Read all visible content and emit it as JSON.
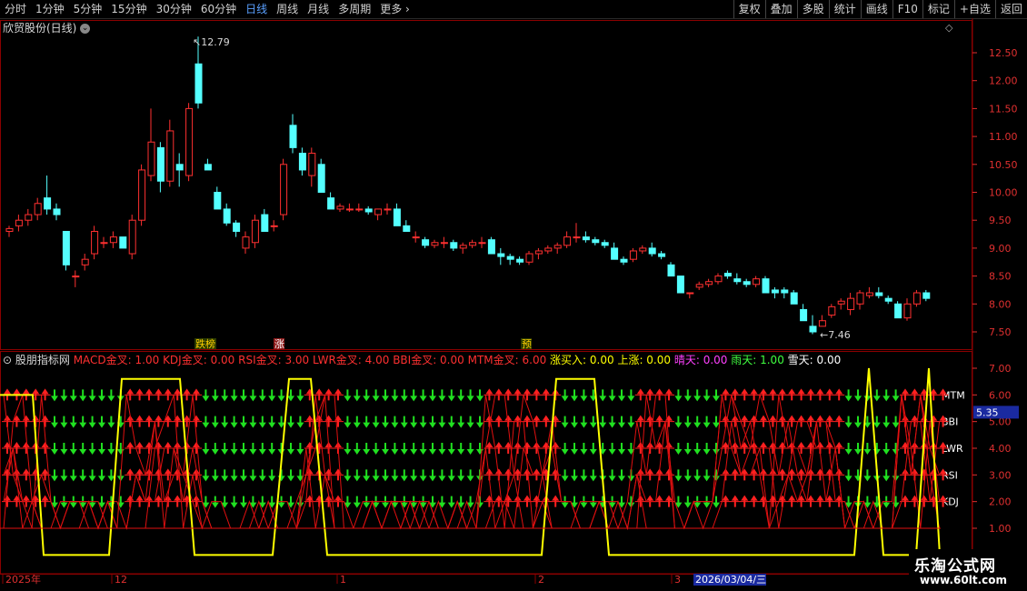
{
  "toolbar": {
    "periods": [
      "分时",
      "1分钟",
      "5分钟",
      "15分钟",
      "30分钟",
      "60分钟",
      "日线",
      "周线",
      "月线",
      "多周期",
      "更多"
    ],
    "active_period": "日线",
    "right_buttons": [
      "复权",
      "叠加",
      "多股",
      "统计",
      "画线",
      "F10",
      "标记",
      "+自选",
      "返回"
    ]
  },
  "price_panel": {
    "title": "欣贸股份(日线)",
    "high_label": "12.79",
    "low_label": "7.46",
    "y_ticks": [
      "12.50",
      "12.00",
      "11.50",
      "11.00",
      "10.50",
      "10.00",
      "9.50",
      "9.00",
      "8.50",
      "8.00",
      "7.50"
    ],
    "markers": [
      {
        "text": "跌榜",
        "color": "#ffd000"
      },
      {
        "text": "涨",
        "color": "#ffffff"
      },
      {
        "text": "预",
        "color": "#ffd000"
      }
    ]
  },
  "indicator_panel": {
    "name": "股朋指标网",
    "legend": [
      {
        "label": "MACD金叉: 1.00",
        "color": "#ff3030"
      },
      {
        "label": "KDJ金叉: 0.00",
        "color": "#ff3030"
      },
      {
        "label": "RSI金叉: 3.00",
        "color": "#ff3030"
      },
      {
        "label": "LWR金叉: 4.00",
        "color": "#ff3030"
      },
      {
        "label": "BBI金叉: 0.00",
        "color": "#ff3030"
      },
      {
        "label": "MTM金叉: 6.00",
        "color": "#ff3030"
      },
      {
        "label": "涨买入: 0.00",
        "color": "#ffff00"
      },
      {
        "label": "上涨: 0.00",
        "color": "#ffff00"
      },
      {
        "label": "晴天: 0.00",
        "color": "#ff40ff"
      },
      {
        "label": "雨天: 1.00",
        "color": "#40ff40"
      },
      {
        "label": "雪天: 0.00",
        "color": "#ffffff"
      }
    ],
    "row_labels": [
      "MTM",
      "BBI",
      "LWR",
      "RSI",
      "KDJ"
    ],
    "y_ticks": [
      "7.00",
      "6.00",
      "5.00",
      "4.00",
      "3.00",
      "2.00",
      "1.00"
    ],
    "current_value": "5.35"
  },
  "date_axis": {
    "labels": [
      "2025年",
      "12",
      "1",
      "2",
      "3"
    ],
    "cursor_date": "2026/03/04/三"
  },
  "watermark": {
    "line1": "乐淘公式网",
    "line2": "www.60lt.com"
  },
  "colors": {
    "up": "#ff3030",
    "down": "#54ffff",
    "yellow": "#ffff00",
    "grid": "#8b0000"
  }
}
